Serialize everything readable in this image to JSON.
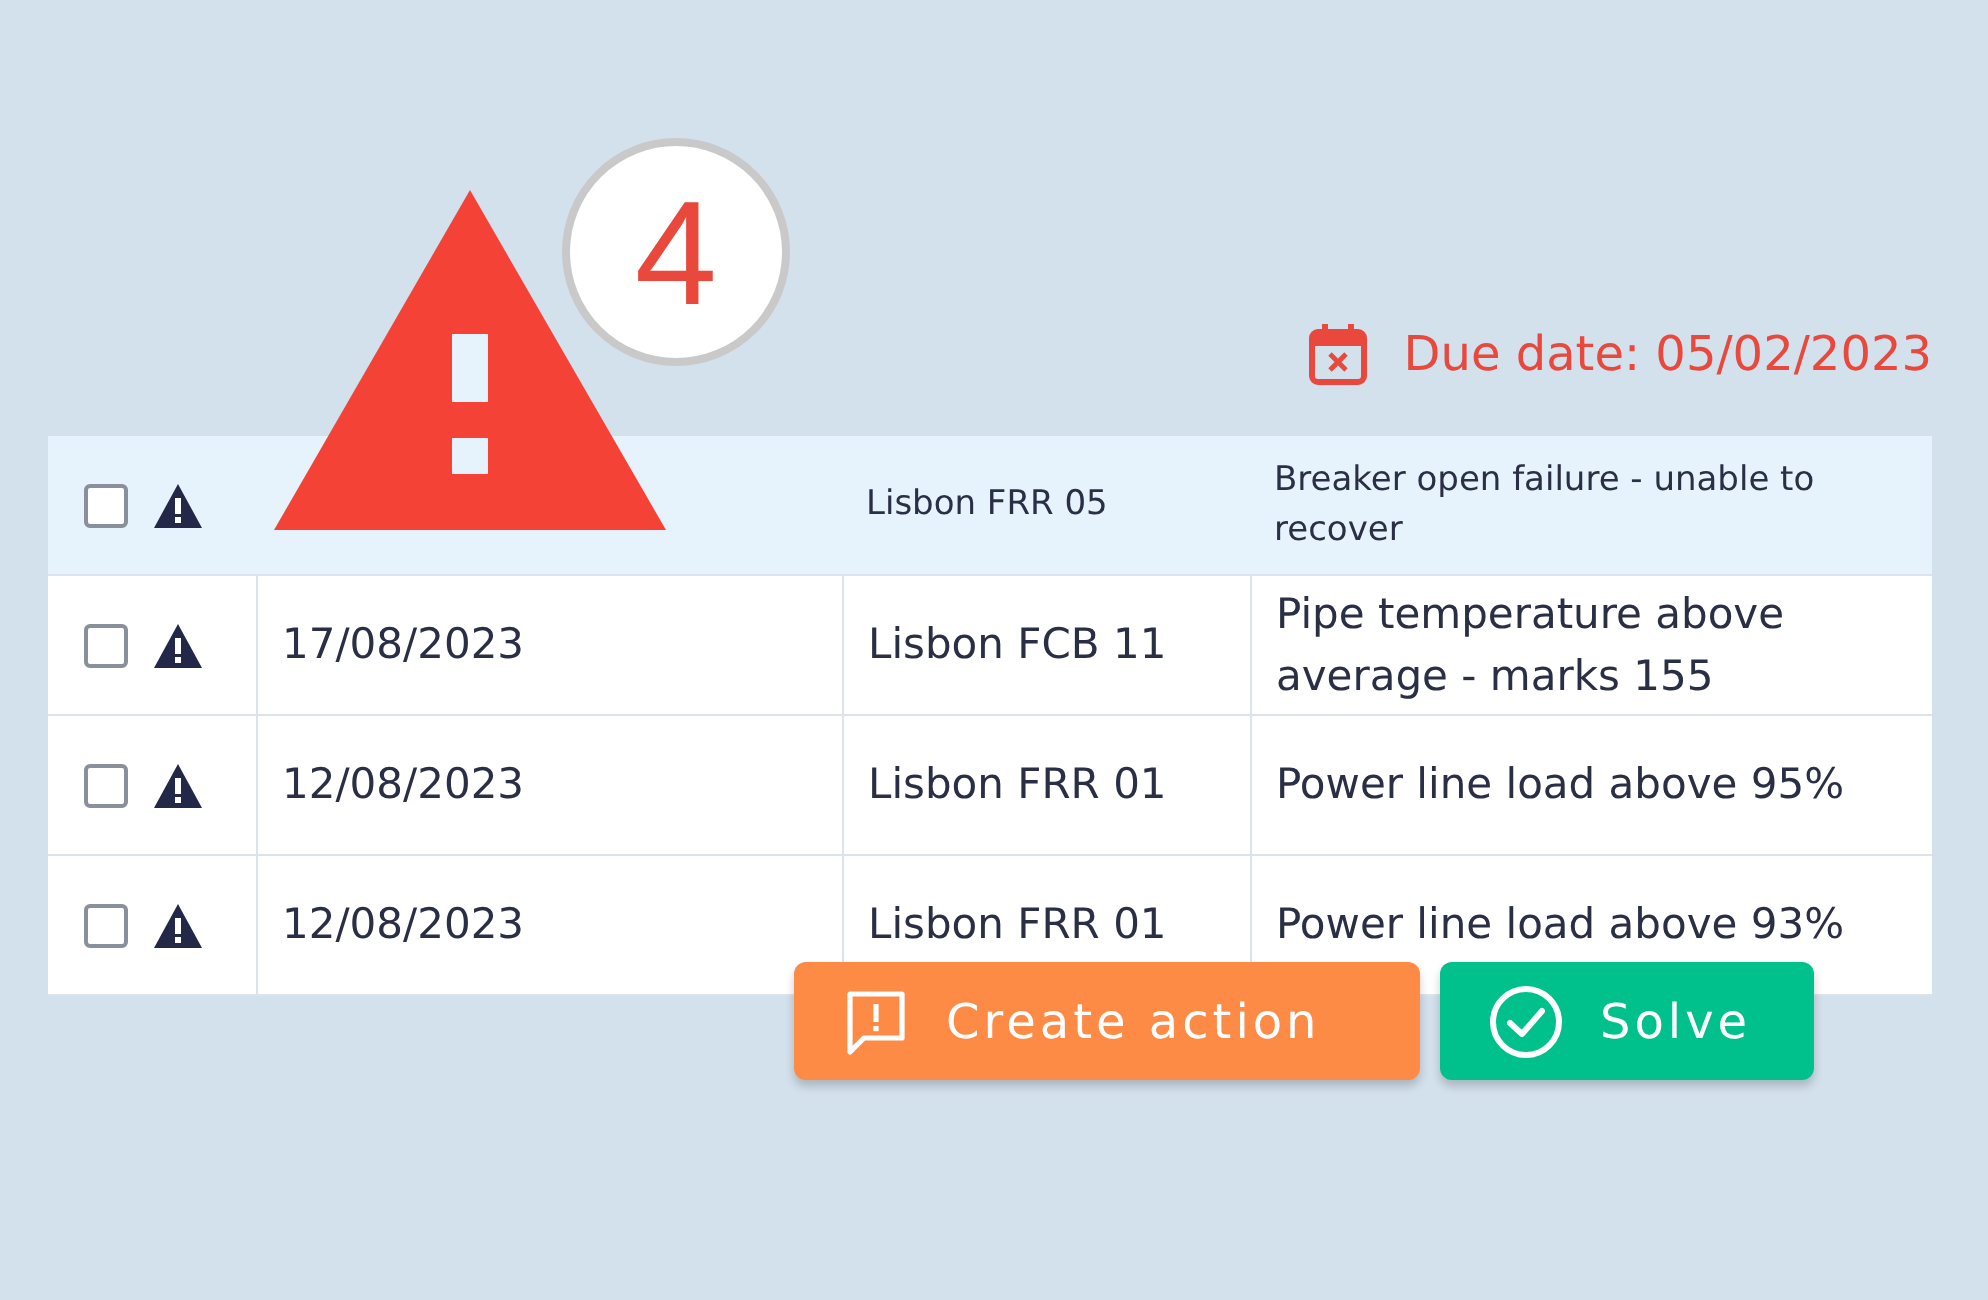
{
  "alert_badge": {
    "count": "4"
  },
  "due_date": {
    "label": "Due date: 05/02/2023"
  },
  "table": {
    "rows": [
      {
        "selected": true,
        "checked": false,
        "location": "Lisbon FRR 05",
        "description": "Breaker open failure - unable to recover"
      },
      {
        "selected": false,
        "checked": false,
        "date": "17/08/2023",
        "location": "Lisbon FCB 11",
        "description": "Pipe temperature above average - marks 155"
      },
      {
        "selected": false,
        "checked": false,
        "date": "12/08/2023",
        "location": "Lisbon FRR 01",
        "description": "Power line load above 95%"
      },
      {
        "selected": false,
        "checked": false,
        "date": "12/08/2023",
        "location": "Lisbon FRR 01",
        "description": "Power line load above 93%"
      }
    ]
  },
  "actions": [
    {
      "kind": "create",
      "label": "Create action"
    },
    {
      "kind": "solve",
      "label": "Solve"
    }
  ]
}
